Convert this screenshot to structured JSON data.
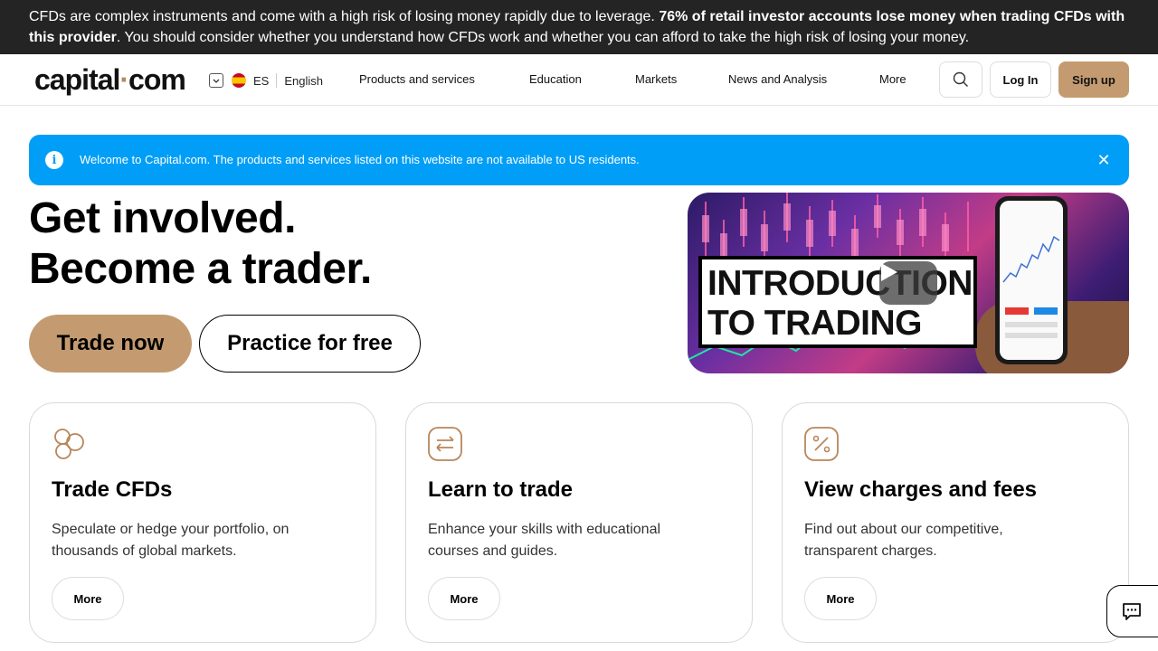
{
  "risk_banner": {
    "text_start": "CFDs are complex instruments and come with a high risk of losing money rapidly due to leverage. ",
    "text_bold": "76% of retail investor accounts lose money when trading CFDs with this provider",
    "text_end": ". You should consider whether you understand how CFDs work and whether you can afford to take the high risk of losing your money."
  },
  "header": {
    "logo_part1": "capital",
    "logo_dot": "·",
    "logo_part2": "com",
    "lang_code": "ES",
    "lang_name": "English",
    "nav": [
      "Products and services",
      "Education",
      "Markets",
      "News and Analysis",
      "More"
    ],
    "login": "Log In",
    "signup": "Sign up"
  },
  "notice": {
    "info_icon": "i",
    "message": "Welcome to Capital.com. The products and services listed on this website are not available to US residents.",
    "close": "✕"
  },
  "hero": {
    "title_line1": "Get involved.",
    "title_line2": "Become a trader.",
    "primary_cta": "Trade now",
    "secondary_cta": "Practice for free",
    "video_caption_line1": "INTRODUCTION",
    "video_caption_line2": "TO TRADING"
  },
  "cards": [
    {
      "title": "Trade CFDs",
      "desc": "Speculate or hedge your portfolio, on thousands of global markets.",
      "button": "More",
      "icon": "coins-icon"
    },
    {
      "title": "Learn to trade",
      "desc": "Enhance your skills with educational courses and guides.",
      "button": "More",
      "icon": "exchange-arrows-icon"
    },
    {
      "title": "View charges and fees",
      "desc": "Find out about our competitive, transparent charges.",
      "button": "More",
      "icon": "percent-icon"
    }
  ],
  "colors": {
    "accent": "#c49b70",
    "notice_bg": "#009ef7",
    "banner_bg": "#242424"
  }
}
